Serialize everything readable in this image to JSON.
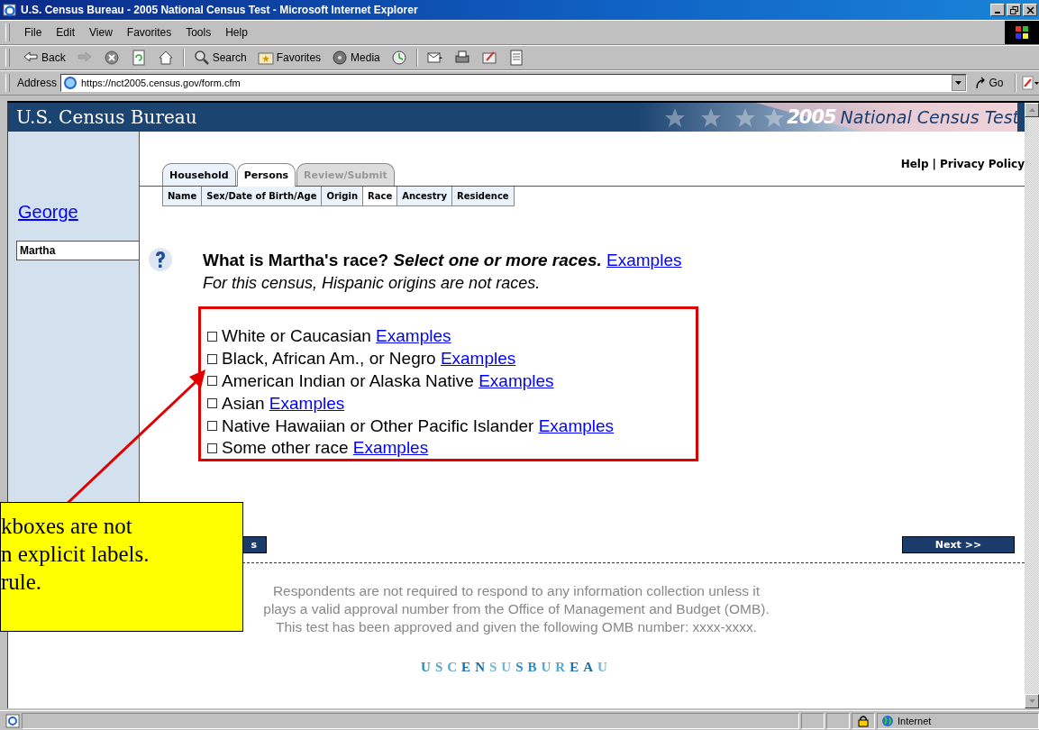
{
  "window": {
    "title": "U.S. Census Bureau - 2005 National Census Test - Microsoft Internet Explorer"
  },
  "menu": [
    "File",
    "Edit",
    "View",
    "Favorites",
    "Tools",
    "Help"
  ],
  "toolbar": [
    {
      "kind": "back",
      "label": "Back"
    },
    {
      "kind": "forward"
    },
    {
      "kind": "stop"
    },
    {
      "kind": "refresh"
    },
    {
      "kind": "home"
    },
    {
      "kind": "search",
      "label": "Search"
    },
    {
      "kind": "favorites",
      "label": "Favorites"
    },
    {
      "kind": "media",
      "label": "Media"
    },
    {
      "kind": "history"
    },
    {
      "kind": "mail"
    },
    {
      "kind": "print"
    },
    {
      "kind": "edit"
    },
    {
      "kind": "discuss"
    }
  ],
  "address": {
    "label": "Address",
    "value": "https://nct2005.census.gov/form.cfm",
    "go": "Go"
  },
  "banner": {
    "title": "U.S. Census Bureau",
    "year": "2005",
    "test_name": "National Census Test"
  },
  "sidebar": {
    "items": [
      {
        "label": "George",
        "selected": false
      },
      {
        "label": "Martha",
        "selected": true
      }
    ]
  },
  "tabs": [
    {
      "label": "Household",
      "selected": false,
      "disabled": false
    },
    {
      "label": "Persons",
      "selected": true,
      "disabled": false
    },
    {
      "label": "Review/Submit",
      "selected": false,
      "disabled": true
    }
  ],
  "subtabs": [
    {
      "label": "Name",
      "selected": false
    },
    {
      "label": "Sex/Date of Birth/Age",
      "selected": false
    },
    {
      "label": "Origin",
      "selected": false
    },
    {
      "label": "Race",
      "selected": true
    },
    {
      "label": "Ancestry",
      "selected": false
    },
    {
      "label": "Residence",
      "selected": false
    }
  ],
  "links": {
    "help": "Help",
    "separator": "|",
    "privacy": "Privacy Policy"
  },
  "question": {
    "text": "What is Martha's race? *Select one or more races.*",
    "link": "Examples",
    "note": "For this census, Hispanic origins are not races."
  },
  "options": [
    {
      "label": "White or Caucasian",
      "link": "Examples",
      "checked": false
    },
    {
      "label": "Black, African Am., or Negro",
      "link": "Examples",
      "checked": false
    },
    {
      "label": "American Indian or Alaska Native",
      "link": "Examples",
      "checked": false
    },
    {
      "label": "Asian",
      "link": "Examples",
      "checked": false
    },
    {
      "label": "Native Hawaiian or Other Pacific Islander",
      "link": "Examples",
      "checked": false
    },
    {
      "label": "Some other race",
      "link": "Examples",
      "checked": false
    }
  ],
  "nav": {
    "back": "s",
    "next": "Next >>"
  },
  "footer": {
    "lines": [
      "Respondents are not required to respond to any information collection unless it",
      "plays a valid approval number from the Office of Management and Budget (OMB).",
      "This test has been approved and given the following OMB number: xxxx-xxxx."
    ],
    "logo": "USCENSUSBUREAU"
  },
  "callout": {
    "lines": [
      "kboxes are not",
      "n explicit labels.",
      "rule."
    ]
  },
  "status_bar": {
    "zone": "Internet"
  }
}
